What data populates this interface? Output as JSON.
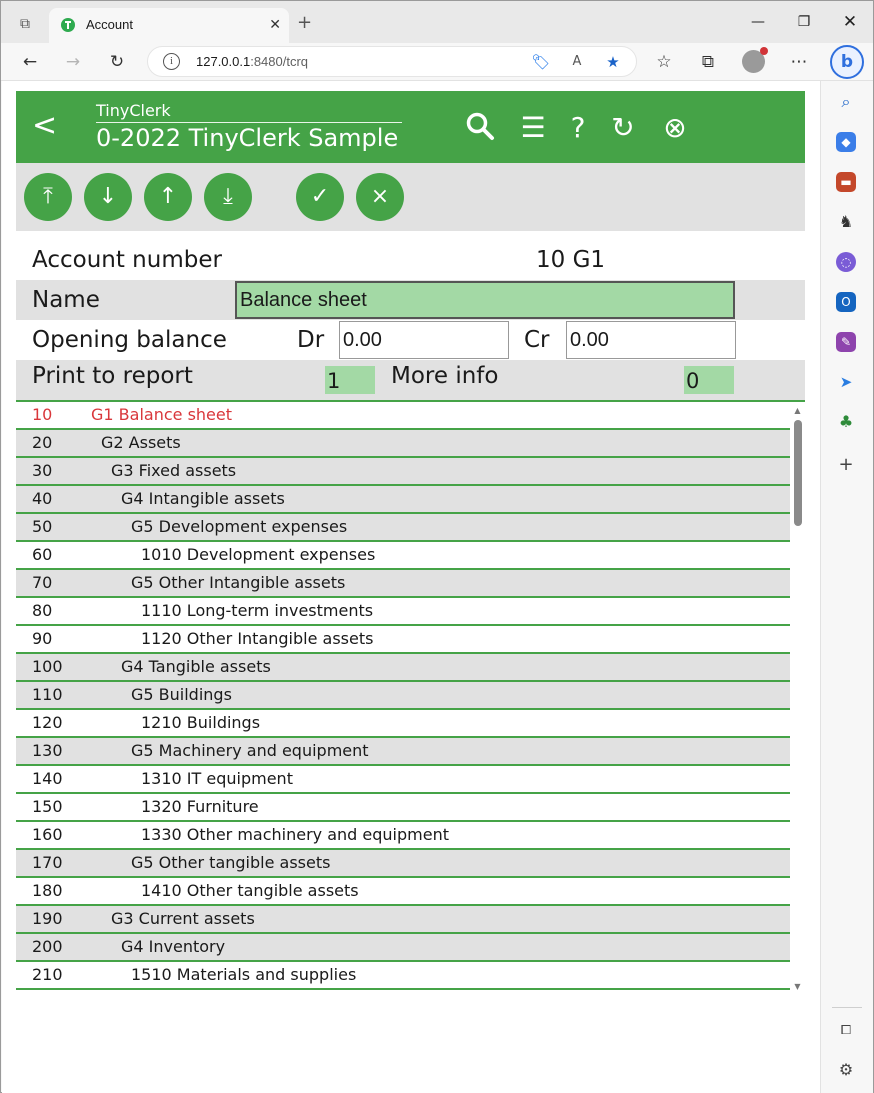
{
  "browser": {
    "tab_title": "Account",
    "url_host": "127.0.0.1",
    "url_rest": ":8480/tcrq",
    "sidebar_icons": [
      "search-icon",
      "tag-icon",
      "toolbox-icon",
      "chess-icon",
      "copilot-icon",
      "outlook-icon",
      "designer-icon",
      "send-icon",
      "tree-icon",
      "plus-icon"
    ]
  },
  "app": {
    "subtitle": "TinyClerk",
    "title": "0-2022 TinyClerk Sample",
    "back_label": "<",
    "help_label": "?",
    "accent": "#45a347"
  },
  "buttons": {
    "first": "⤒",
    "down": "↓",
    "up": "↑",
    "last": "⤓",
    "ok": "✓",
    "cancel": "×"
  },
  "form": {
    "account_number_label": "Account number",
    "account_number_value": "10 G1",
    "name_label": "Name",
    "name_value": "Balance sheet",
    "opening_balance_label": "Opening balance",
    "dr_label": "Dr",
    "dr_value": "0.00",
    "cr_label": "Cr",
    "cr_value": "0.00",
    "print_label": "Print to report",
    "print_value": "1",
    "more_info_label": "More info",
    "more_info_value": "0"
  },
  "accounts": [
    {
      "num": "10",
      "text": "G1 Balance sheet",
      "level": 0,
      "shade": false,
      "selected": true
    },
    {
      "num": "20",
      "text": "G2 Assets",
      "level": 1,
      "shade": true,
      "selected": false
    },
    {
      "num": "30",
      "text": "G3 Fixed assets",
      "level": 2,
      "shade": true,
      "selected": false
    },
    {
      "num": "40",
      "text": "G4 Intangible assets",
      "level": 3,
      "shade": true,
      "selected": false
    },
    {
      "num": "50",
      "text": "G5 Development expenses",
      "level": 4,
      "shade": true,
      "selected": false
    },
    {
      "num": "60",
      "text": "1010 Development expenses",
      "level": 5,
      "shade": false,
      "selected": false
    },
    {
      "num": "70",
      "text": "G5 Other Intangible assets",
      "level": 4,
      "shade": true,
      "selected": false
    },
    {
      "num": "80",
      "text": "1110 Long-term investments",
      "level": 5,
      "shade": false,
      "selected": false
    },
    {
      "num": "90",
      "text": "1120 Other Intangible assets",
      "level": 5,
      "shade": false,
      "selected": false
    },
    {
      "num": "100",
      "text": "G4 Tangible assets",
      "level": 3,
      "shade": true,
      "selected": false
    },
    {
      "num": "110",
      "text": "G5 Buildings",
      "level": 4,
      "shade": true,
      "selected": false
    },
    {
      "num": "120",
      "text": "1210 Buildings",
      "level": 5,
      "shade": false,
      "selected": false
    },
    {
      "num": "130",
      "text": "G5 Machinery and equipment",
      "level": 4,
      "shade": true,
      "selected": false
    },
    {
      "num": "140",
      "text": "1310 IT equipment",
      "level": 5,
      "shade": false,
      "selected": false
    },
    {
      "num": "150",
      "text": "1320 Furniture",
      "level": 5,
      "shade": false,
      "selected": false
    },
    {
      "num": "160",
      "text": "1330 Other machinery and equipment",
      "level": 5,
      "shade": false,
      "selected": false
    },
    {
      "num": "170",
      "text": "G5 Other tangible assets",
      "level": 4,
      "shade": true,
      "selected": false
    },
    {
      "num": "180",
      "text": "1410 Other tangible assets",
      "level": 5,
      "shade": false,
      "selected": false
    },
    {
      "num": "190",
      "text": "G3 Current assets",
      "level": 2,
      "shade": true,
      "selected": false
    },
    {
      "num": "200",
      "text": "G4 Inventory",
      "level": 3,
      "shade": true,
      "selected": false
    },
    {
      "num": "210",
      "text": "1510 Materials and supplies",
      "level": 4,
      "shade": false,
      "selected": false
    }
  ]
}
